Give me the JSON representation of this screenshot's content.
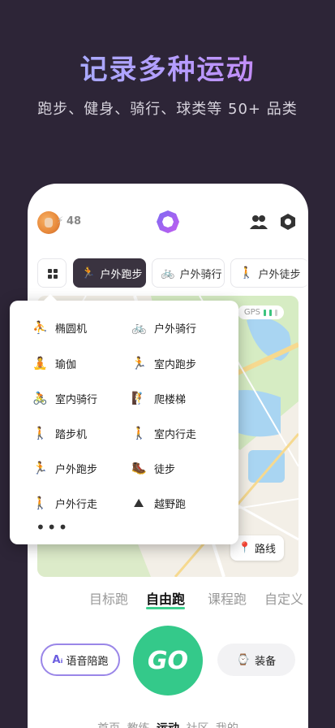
{
  "headline": "记录多种运动",
  "subline": "跑步、健身、骑行、球类等 50+ 品类",
  "topbar": {
    "score": "48"
  },
  "tabs": [
    {
      "label": "户外跑步",
      "icon": "run-icon"
    },
    {
      "label": "户外骑行",
      "icon": "bike-icon"
    },
    {
      "label": "户外徒步",
      "icon": "walk-icon"
    }
  ],
  "map": {
    "gps_label": "GPS",
    "route_label": "路线"
  },
  "menu": {
    "items": [
      {
        "label": "椭圆机",
        "icon": "elliptical-icon"
      },
      {
        "label": "户外骑行",
        "icon": "bike-icon"
      },
      {
        "label": "瑜伽",
        "icon": "yoga-icon"
      },
      {
        "label": "室内跑步",
        "icon": "treadmill-run-icon"
      },
      {
        "label": "室内骑行",
        "icon": "indoor-bike-icon"
      },
      {
        "label": "爬楼梯",
        "icon": "stairs-icon"
      },
      {
        "label": "踏步机",
        "icon": "stepper-icon"
      },
      {
        "label": "室内行走",
        "icon": "indoor-walk-icon"
      },
      {
        "label": "户外跑步",
        "icon": "run-icon"
      },
      {
        "label": "徒步",
        "icon": "hike-icon"
      },
      {
        "label": "户外行走",
        "icon": "walk-icon"
      },
      {
        "label": "越野跑",
        "icon": "trail-run-icon"
      }
    ],
    "more": "•••"
  },
  "modes": [
    "目标跑",
    "自由跑",
    "课程跑",
    "自定义"
  ],
  "actions": {
    "voice": "语音陪跑",
    "go": "GO",
    "equip": "装备"
  },
  "bottom_nav": [
    "首页",
    "教练",
    "运动",
    "社区",
    "我的"
  ],
  "colors": {
    "accent": "#34c98a",
    "background": "#2d2537"
  }
}
